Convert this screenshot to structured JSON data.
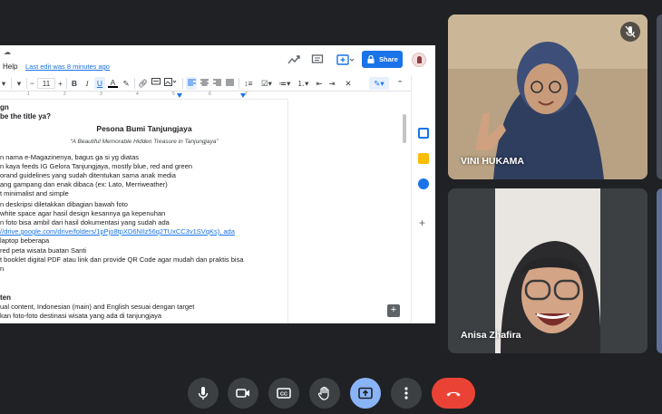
{
  "doc": {
    "menu_help": "Help",
    "last_edit": "Last edit was 8 minutes ago",
    "share_label": "Share",
    "toolbar": {
      "zoom_minus": "−",
      "font_size": "11",
      "zoom_plus": "+",
      "bold": "B",
      "italic": "I",
      "underline": "U",
      "text_color": "A",
      "clear_format": "✕"
    },
    "ruler_numbers": [
      "1",
      "2",
      "3",
      "4",
      "5",
      "6",
      "7"
    ],
    "lines": [
      {
        "text": "gn",
        "style": "bold"
      },
      {
        "text": "be the title ya?",
        "style": "bold"
      },
      {
        "text": "Pesona Bumi Tanjungjaya",
        "style": "title"
      },
      {
        "text": "“A Beautiful Memorable Hidden Treasure in Tanjungjaya”",
        "style": "italic"
      },
      {
        "text": "n nama e-Magazinenya, bagus ga si yg diatas",
        "style": "normal"
      },
      {
        "text": "n kaya feeds IG Gelora Tanjungjaya, mostly blue, red and green",
        "style": "normal"
      },
      {
        "text": "orand guidelines yang sudah ditentukan sama anak media",
        "style": "normal"
      },
      {
        "text": "ang gampang dan enak dibaca (ex: Lato, Merriweather)",
        "style": "normal"
      },
      {
        "text": "t minimalist and simple",
        "style": "normal"
      },
      {
        "text": "n deskripsi diletakkan dibagian bawah foto",
        "style": "normal"
      },
      {
        "text": "white space agar hasil design kesannya ga kepenuhan",
        "style": "normal"
      },
      {
        "text": "n foto bisa ambil dari hasil dokumentasi yang sudah ada",
        "style": "normal"
      },
      {
        "text": "//drive.google.com/drive/folders/1pPjo8tpXD6NIlz56q2TUxCC3v1SVqKs), ada",
        "style": "link"
      },
      {
        "text": "laptop beberapa",
        "style": "normal"
      },
      {
        "text": "red peta wisata buatan Santi",
        "style": "normal"
      },
      {
        "text": "t booklet digital PDF atau link dan provide QR Code agar mudah dan praktis bisa",
        "style": "normal"
      },
      {
        "text": "n",
        "style": "normal"
      },
      {
        "text": "",
        "style": "normal"
      },
      {
        "text": "",
        "style": "normal"
      },
      {
        "text": "ten",
        "style": "bold"
      },
      {
        "text": "ual content, Indonesian (main) and English sesuai dengan target",
        "style": "normal"
      },
      {
        "text": "kan foto-foto destinasi wisata yang ada di tanjungjaya",
        "style": "normal"
      }
    ]
  },
  "participants": [
    {
      "name": "VINI HUKAMA",
      "muted": true
    },
    {
      "name": "Anisa Zhafira",
      "muted": false
    }
  ],
  "controls": [
    {
      "id": "mic",
      "icon": "microphone-icon"
    },
    {
      "id": "camera",
      "icon": "camera-icon"
    },
    {
      "id": "captions",
      "icon": "captions-icon"
    },
    {
      "id": "raise-hand",
      "icon": "hand-icon"
    },
    {
      "id": "present",
      "icon": "present-screen-icon"
    },
    {
      "id": "more",
      "icon": "more-vert-icon"
    },
    {
      "id": "leave",
      "icon": "phone-hangup-icon"
    }
  ],
  "colors": {
    "meet_bg": "#202124",
    "share_blue": "#1a73e8",
    "present_active": "#8ab4f8",
    "leave_red": "#ea4335",
    "control_dark": "#3c4043"
  }
}
